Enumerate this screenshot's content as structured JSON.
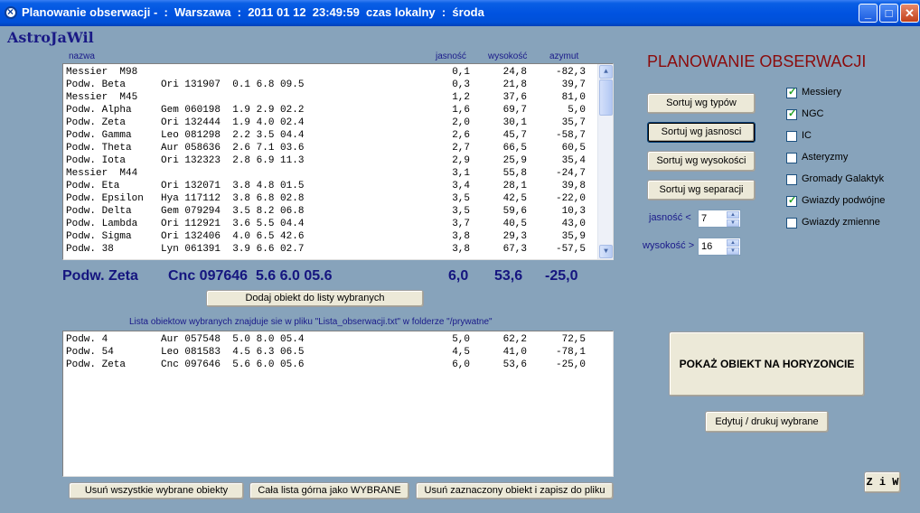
{
  "window": {
    "title": "Planowanie obserwacji -  :  Warszawa  :  2011 01 12  23:49:59  czas lokalny  :  środa",
    "minimize": "_",
    "maximize": "□",
    "close": "✕"
  },
  "app_name": "AstroJaWil",
  "columns": {
    "name": "nazwa",
    "brightness": "jasność",
    "altitude": "wysokość",
    "azimuth": "azymut"
  },
  "top_list": [
    {
      "name": "Messier  M98",
      "info": "",
      "mag": "0,1",
      "alt": "24,8",
      "az": "-82,3"
    },
    {
      "name": "Podw. Beta",
      "info": "Ori 131907  0.1 6.8 09.5",
      "mag": "0,3",
      "alt": "21,8",
      "az": "39,7"
    },
    {
      "name": "Messier  M45",
      "info": "",
      "mag": "1,2",
      "alt": "37,6",
      "az": "81,0"
    },
    {
      "name": "Podw. Alpha",
      "info": "Gem 060198  1.9 2.9 02.2",
      "mag": "1,6",
      "alt": "69,7",
      "az": "5,0"
    },
    {
      "name": "Podw. Zeta",
      "info": "Ori 132444  1.9 4.0 02.4",
      "mag": "2,0",
      "alt": "30,1",
      "az": "35,7"
    },
    {
      "name": "Podw. Gamma",
      "info": "Leo 081298  2.2 3.5 04.4",
      "mag": "2,6",
      "alt": "45,7",
      "az": "-58,7"
    },
    {
      "name": "Podw. Theta",
      "info": "Aur 058636  2.6 7.1 03.6",
      "mag": "2,7",
      "alt": "66,5",
      "az": "60,5"
    },
    {
      "name": "Podw. Iota",
      "info": "Ori 132323  2.8 6.9 11.3",
      "mag": "2,9",
      "alt": "25,9",
      "az": "35,4"
    },
    {
      "name": "Messier  M44",
      "info": "",
      "mag": "3,1",
      "alt": "55,8",
      "az": "-24,7"
    },
    {
      "name": "Podw. Eta",
      "info": "Ori 132071  3.8 4.8 01.5",
      "mag": "3,4",
      "alt": "28,1",
      "az": "39,8"
    },
    {
      "name": "Podw. Epsilon",
      "info": "Hya 117112  3.8 6.8 02.8",
      "mag": "3,5",
      "alt": "42,5",
      "az": "-22,0"
    },
    {
      "name": "Podw. Delta",
      "info": "Gem 079294  3.5 8.2 06.8",
      "mag": "3,5",
      "alt": "59,6",
      "az": "10,3"
    },
    {
      "name": "Podw. Lambda",
      "info": "Ori 112921  3.6 5.5 04.4",
      "mag": "3,7",
      "alt": "40,5",
      "az": "43,0"
    },
    {
      "name": "Podw. Sigma",
      "info": "Ori 132406  4.0 6.5 42.6",
      "mag": "3,8",
      "alt": "29,3",
      "az": "35,9"
    },
    {
      "name": "Podw. 38",
      "info": "Lyn 061391  3.9 6.6 02.7",
      "mag": "3,8",
      "alt": "67,3",
      "az": "-57,5"
    }
  ],
  "current_object": {
    "name": "Podw. Zeta",
    "info": "Cnc 097646  5.6 6.0 05.6",
    "mag": "6,0",
    "alt": "53,6",
    "az": "-25,0"
  },
  "add_button": "Dodaj obiekt do listy wybranych",
  "selected_info": "Lista obiektow wybranych znajduje sie w pliku \"Lista_obserwacji.txt\" w folderze \"/prywatne\"",
  "selected_list": [
    {
      "name": "Podw. 4",
      "info": "Aur 057548  5.0 8.0 05.4",
      "mag": "5,0",
      "alt": "62,2",
      "az": "72,5"
    },
    {
      "name": "Podw. 54",
      "info": "Leo 081583  4.5 6.3 06.5",
      "mag": "4,5",
      "alt": "41,0",
      "az": "-78,1"
    },
    {
      "name": "Podw. Zeta",
      "info": "Cnc 097646  5.6 6.0 05.6",
      "mag": "6,0",
      "alt": "53,6",
      "az": "-25,0"
    }
  ],
  "bottom_buttons": {
    "remove_all": "Usuń wszystkie wybrane obiekty",
    "all_selected": "Cała lista górna jako WYBRANE",
    "remove_marked": "Usuń zaznaczony obiekt i zapisz do pliku"
  },
  "heading": "PLANOWANIE OBSERWACJI",
  "sort_buttons": {
    "types": "Sortuj wg typów",
    "brightness": "Sortuj wg jasnosci",
    "altitude": "Sortuj wg wysokości",
    "separation": "Sortuj wg separacji"
  },
  "filters": {
    "brightness_label": "jasność <",
    "brightness_value": "7",
    "altitude_label": "wysokość >",
    "altitude_value": "16"
  },
  "checkboxes": [
    {
      "label": "Messiery",
      "checked": true
    },
    {
      "label": "NGC",
      "checked": true
    },
    {
      "label": "IC",
      "checked": false
    },
    {
      "label": "Asteryzmy",
      "checked": false
    },
    {
      "label": "Gromady Galaktyk",
      "checked": false
    },
    {
      "label": "Gwiazdy podwójne",
      "checked": true
    },
    {
      "label": "Gwiazdy zmienne",
      "checked": false
    }
  ],
  "show_horizon": "POKAŻ OBIEKT NA HORYZONCIE",
  "edit_print": "Edytuj / drukuj wybrane",
  "ziw": "Z i W"
}
